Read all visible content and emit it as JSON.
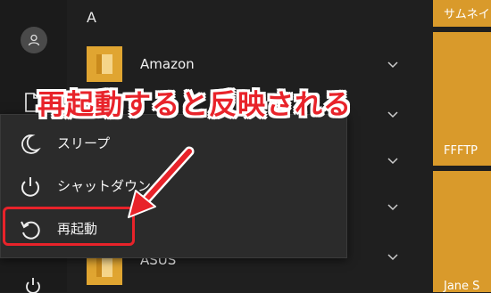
{
  "annotation": {
    "text": "再起動すると反映される",
    "color": "#e8232a"
  },
  "start_menu": {
    "section_letter": "A",
    "apps": [
      {
        "name": "Amazon",
        "icon": "folder-icon"
      },
      {
        "name": "",
        "icon": "folder-icon"
      },
      {
        "name": "ASUS",
        "icon": "folder-icon"
      }
    ],
    "tiles": [
      {
        "label": "サムネイ"
      },
      {
        "label": "FFFTP"
      },
      {
        "label": "Jane S"
      }
    ],
    "accent_color": "#d99a2b"
  },
  "power_menu": {
    "items": [
      {
        "label": "スリープ",
        "icon": "moon-icon"
      },
      {
        "label": "シャットダウン",
        "icon": "power-icon"
      },
      {
        "label": "再起動",
        "icon": "restart-icon",
        "highlighted": true
      }
    ]
  }
}
